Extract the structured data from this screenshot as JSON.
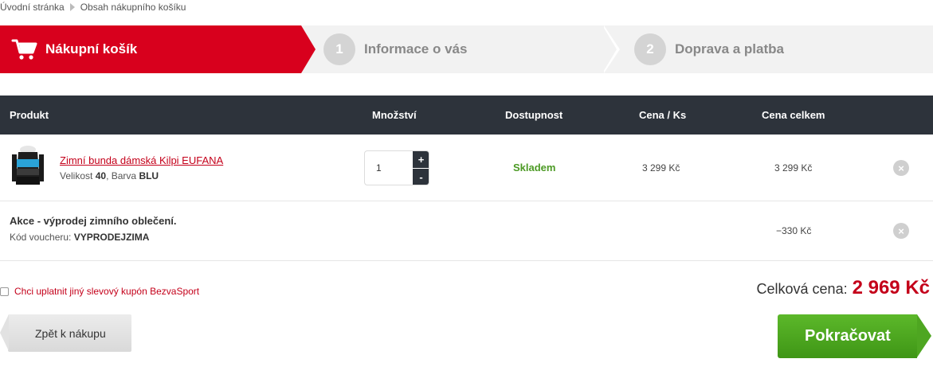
{
  "breadcrumb": {
    "home": "Úvodní stránka",
    "current": "Obsah nákupního košíku"
  },
  "steps": [
    {
      "number": "",
      "label": "Nákupní košík",
      "active": true,
      "icon": "cart-icon"
    },
    {
      "number": "1",
      "label": "Informace o vás",
      "active": false
    },
    {
      "number": "2",
      "label": "Doprava a platba",
      "active": false
    }
  ],
  "table": {
    "headers": {
      "product": "Produkt",
      "quantity": "Množství",
      "availability": "Dostupnost",
      "unit_price": "Cena / Ks",
      "total_price": "Cena celkem"
    },
    "item": {
      "name": "Zimní bunda dámská Kilpi EUFANA",
      "size_label": "Velikost",
      "size": "40",
      "color_label": "Barva",
      "color": "BLU",
      "quantity": "1",
      "plus": "+",
      "minus": "-",
      "availability": "Skladem",
      "unit_price": "3 299 Kč",
      "total_price": "3 299 Kč",
      "remove": "×"
    },
    "discount": {
      "title": "Akce - výprodej zimního oblečení.",
      "code_label": "Kód voucheru:",
      "code": "VYPRODEJZIMA",
      "amount": "−330 Kč",
      "remove": "×"
    }
  },
  "coupon": {
    "label": "Chci uplatnit jiný slevový kupón BezvaSport",
    "checked": false
  },
  "total": {
    "label": "Celková cena:",
    "value": "2 969 Kč"
  },
  "buttons": {
    "back": "Zpět k nákupu",
    "next": "Pokračovat"
  },
  "colors": {
    "accent": "#d8001d",
    "header": "#2d333b",
    "available": "#4c9a24",
    "continue": "#4ea621"
  }
}
